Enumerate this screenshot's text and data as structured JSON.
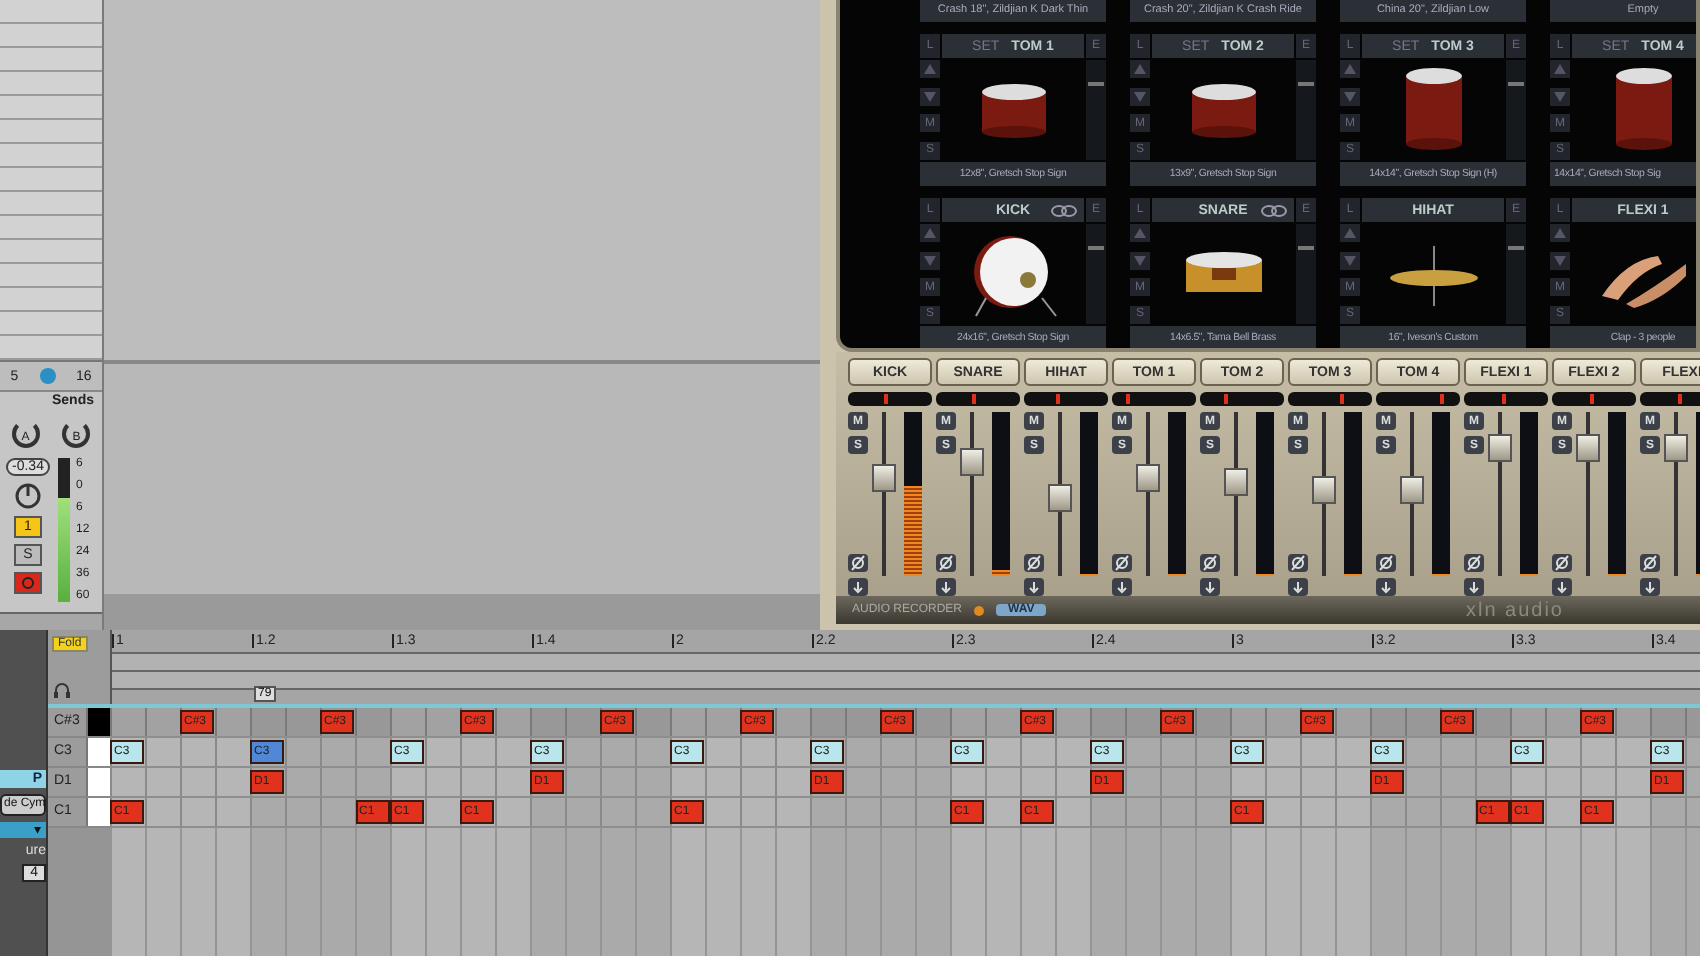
{
  "track": {
    "top": {
      "number": "5",
      "count": "16"
    },
    "sends_label": "Sends",
    "sends": [
      {
        "letter": "A"
      },
      {
        "letter": "B"
      }
    ],
    "volume": "-0.34",
    "meter": {
      "level": 0.72
    },
    "meter_scale": [
      "6",
      "0",
      "6",
      "12",
      "24",
      "36",
      "60"
    ],
    "track_button": {
      "label": "1",
      "on": true
    },
    "solo": {
      "label": "S",
      "on": false
    },
    "arm": {
      "on": true
    }
  },
  "plugin": {
    "top_captions": [
      "Crash 18\", Zildjian K Dark Thin",
      "Crash 20\", Zildjian K Crash Ride",
      "China 20\", Zildjian Low",
      "Empty"
    ],
    "pads": [
      {
        "label": "TOM 1",
        "set": "SET",
        "caption": "12x8\", Gretsch Stop Sign",
        "kind": "tom",
        "linked": false,
        "lock": "L",
        "edit": "E",
        "mute": "M",
        "solo": "S",
        "volume": {
          "level": 0.75
        }
      },
      {
        "label": "TOM 2",
        "set": "SET",
        "caption": "13x9\", Gretsch Stop Sign",
        "kind": "tom",
        "linked": false,
        "lock": "L",
        "edit": "E",
        "mute": "M",
        "solo": "S",
        "volume": {
          "level": 0.75
        }
      },
      {
        "label": "TOM 3",
        "set": "SET",
        "caption": "14x14\", Gretsch Stop Sign (H)",
        "kind": "floor-tom",
        "linked": false,
        "lock": "L",
        "edit": "E",
        "mute": "M",
        "solo": "S",
        "volume": {
          "level": 0.75
        }
      },
      {
        "label": "TOM 4",
        "set": "SET",
        "caption": "14x14\", Gretsch Stop Sig",
        "kind": "floor-tom",
        "linked": false,
        "lock": "L",
        "mute": "M",
        "solo": "S"
      },
      {
        "label": "KICK",
        "caption": "24x16\", Gretsch Stop Sign",
        "kind": "kick",
        "linked": true,
        "lock": "L",
        "edit": "E",
        "mute": "M",
        "solo": "S",
        "volume": {
          "level": 0.75
        }
      },
      {
        "label": "SNARE",
        "caption": "14x6.5\", Tama Bell Brass",
        "kind": "snare",
        "linked": true,
        "lock": "L",
        "edit": "E",
        "mute": "M",
        "solo": "S",
        "volume": {
          "level": 0.75
        }
      },
      {
        "label": "HIHAT",
        "caption": "16\", Iveson's Custom",
        "kind": "hihat",
        "linked": false,
        "lock": "L",
        "edit": "E",
        "mute": "M",
        "solo": "S",
        "volume": {
          "level": 0.75
        }
      },
      {
        "label": "FLEXI 1",
        "caption": "Clap - 3 people",
        "kind": "clap",
        "linked": false,
        "lock": "L",
        "mute": "M",
        "solo": "S"
      }
    ],
    "mixer": [
      {
        "name": "KICK",
        "mute": "M",
        "solo": "S",
        "pan": {
          "level": 0.45
        },
        "fader": {
          "level": 0.6
        },
        "meter": {
          "level": 0.55
        }
      },
      {
        "name": "SNARE",
        "mute": "M",
        "solo": "S",
        "pan": {
          "level": 0.45
        },
        "fader": {
          "level": 0.7
        },
        "meter": {
          "level": 0.04
        }
      },
      {
        "name": "HIHAT",
        "mute": "M",
        "solo": "S",
        "pan": {
          "level": 0.4
        },
        "fader": {
          "level": 0.48
        },
        "meter": {
          "level": 0
        }
      },
      {
        "name": "TOM 1",
        "mute": "M",
        "solo": "S",
        "pan": {
          "level": 0.2
        },
        "fader": {
          "level": 0.6
        },
        "meter": {
          "level": 0
        }
      },
      {
        "name": "TOM 2",
        "mute": "M",
        "solo": "S",
        "pan": {
          "level": 0.3
        },
        "fader": {
          "level": 0.57
        },
        "meter": {
          "level": 0
        }
      },
      {
        "name": "TOM 3",
        "mute": "M",
        "solo": "S",
        "pan": {
          "level": 0.65
        },
        "fader": {
          "level": 0.52
        },
        "meter": {
          "level": 0
        }
      },
      {
        "name": "TOM 4",
        "mute": "M",
        "solo": "S",
        "pan": {
          "level": 0.78
        },
        "fader": {
          "level": 0.52
        },
        "meter": {
          "level": 0
        }
      },
      {
        "name": "FLEXI 1",
        "mute": "M",
        "solo": "S",
        "pan": {
          "level": 0.48
        },
        "fader": {
          "level": 0.78
        },
        "meter": {
          "level": 0
        }
      },
      {
        "name": "FLEXI 2",
        "mute": "M",
        "solo": "S",
        "pan": {
          "level": 0.48
        },
        "fader": {
          "level": 0.78
        },
        "meter": {
          "level": 0
        }
      },
      {
        "name": "FLEXI",
        "mute": "M",
        "solo": "S",
        "pan": {
          "level": 0.48
        },
        "fader": {
          "level": 0.78
        },
        "meter": {
          "level": 0
        }
      }
    ],
    "footer": {
      "recorder": "AUDIO RECORDER",
      "format": "WAV",
      "logo": "xln audio"
    }
  },
  "clip": {
    "header": "P",
    "name": "de Cym",
    "dropdown": "▾",
    "signature_label": "ure",
    "signature": "4"
  },
  "piano_roll": {
    "fold": "Fold",
    "ruler": [
      "1",
      "1.2",
      "1.3",
      "1.4",
      "2",
      "2.2",
      "2.3",
      "2.4",
      "3",
      "3.2",
      "3.3",
      "3.4"
    ],
    "marker": "79",
    "rows": [
      {
        "key": "C#3",
        "black": true,
        "color": "#e0321c",
        "steps": [
          {
            "kind": "rest"
          },
          {
            "kind": "rest"
          },
          {
            "kind": "note",
            "label": "C#3",
            "selected": false
          },
          {
            "kind": "rest"
          },
          {
            "kind": "rest"
          },
          {
            "kind": "rest"
          },
          {
            "kind": "note",
            "label": "C#3",
            "selected": false
          },
          {
            "kind": "rest"
          },
          {
            "kind": "rest"
          },
          {
            "kind": "rest"
          },
          {
            "kind": "note",
            "label": "C#3",
            "selected": false
          },
          {
            "kind": "rest"
          },
          {
            "kind": "rest"
          },
          {
            "kind": "rest"
          },
          {
            "kind": "note",
            "label": "C#3",
            "selected": false
          },
          {
            "kind": "rest"
          },
          {
            "kind": "rest"
          },
          {
            "kind": "rest"
          },
          {
            "kind": "note",
            "label": "C#3",
            "selected": false
          },
          {
            "kind": "rest"
          },
          {
            "kind": "rest"
          },
          {
            "kind": "rest"
          },
          {
            "kind": "note",
            "label": "C#3",
            "selected": false
          },
          {
            "kind": "rest"
          },
          {
            "kind": "rest"
          },
          {
            "kind": "rest"
          },
          {
            "kind": "note",
            "label": "C#3",
            "selected": false
          },
          {
            "kind": "rest"
          },
          {
            "kind": "rest"
          },
          {
            "kind": "rest"
          },
          {
            "kind": "note",
            "label": "C#3",
            "selected": false
          },
          {
            "kind": "rest"
          },
          {
            "kind": "rest"
          },
          {
            "kind": "rest"
          },
          {
            "kind": "note",
            "label": "C#3",
            "selected": false
          },
          {
            "kind": "rest"
          },
          {
            "kind": "rest"
          },
          {
            "kind": "rest"
          },
          {
            "kind": "note",
            "label": "C#3",
            "selected": false
          },
          {
            "kind": "rest"
          },
          {
            "kind": "rest"
          },
          {
            "kind": "rest"
          },
          {
            "kind": "note",
            "label": "C#3",
            "selected": false
          }
        ]
      },
      {
        "key": "C3",
        "black": false,
        "color": "#b9e6ec",
        "steps": [
          {
            "kind": "note",
            "label": "C3",
            "selected": false
          },
          {
            "kind": "rest"
          },
          {
            "kind": "rest"
          },
          {
            "kind": "rest"
          },
          {
            "kind": "note",
            "label": "C3",
            "selected": true
          },
          {
            "kind": "rest"
          },
          {
            "kind": "rest"
          },
          {
            "kind": "rest"
          },
          {
            "kind": "note",
            "label": "C3",
            "selected": false
          },
          {
            "kind": "rest"
          },
          {
            "kind": "rest"
          },
          {
            "kind": "rest"
          },
          {
            "kind": "note",
            "label": "C3",
            "selected": false
          },
          {
            "kind": "rest"
          },
          {
            "kind": "rest"
          },
          {
            "kind": "rest"
          },
          {
            "kind": "note",
            "label": "C3",
            "selected": false
          },
          {
            "kind": "rest"
          },
          {
            "kind": "rest"
          },
          {
            "kind": "rest"
          },
          {
            "kind": "note",
            "label": "C3",
            "selected": false
          },
          {
            "kind": "rest"
          },
          {
            "kind": "rest"
          },
          {
            "kind": "rest"
          },
          {
            "kind": "note",
            "label": "C3",
            "selected": false
          },
          {
            "kind": "rest"
          },
          {
            "kind": "rest"
          },
          {
            "kind": "rest"
          },
          {
            "kind": "note",
            "label": "C3",
            "selected": false
          },
          {
            "kind": "rest"
          },
          {
            "kind": "rest"
          },
          {
            "kind": "rest"
          },
          {
            "kind": "note",
            "label": "C3",
            "selected": false
          },
          {
            "kind": "rest"
          },
          {
            "kind": "rest"
          },
          {
            "kind": "rest"
          },
          {
            "kind": "note",
            "label": "C3",
            "selected": false
          },
          {
            "kind": "rest"
          },
          {
            "kind": "rest"
          },
          {
            "kind": "rest"
          },
          {
            "kind": "note",
            "label": "C3",
            "selected": false
          },
          {
            "kind": "rest"
          },
          {
            "kind": "rest"
          },
          {
            "kind": "rest"
          },
          {
            "kind": "note",
            "label": "C3",
            "selected": false
          }
        ]
      },
      {
        "key": "D1",
        "black": false,
        "color": "#e0321c",
        "steps": [
          {
            "kind": "rest"
          },
          {
            "kind": "rest"
          },
          {
            "kind": "rest"
          },
          {
            "kind": "rest"
          },
          {
            "kind": "note",
            "label": "D1",
            "selected": false
          },
          {
            "kind": "rest"
          },
          {
            "kind": "rest"
          },
          {
            "kind": "rest"
          },
          {
            "kind": "rest"
          },
          {
            "kind": "rest"
          },
          {
            "kind": "rest"
          },
          {
            "kind": "rest"
          },
          {
            "kind": "note",
            "label": "D1",
            "selected": false
          },
          {
            "kind": "rest"
          },
          {
            "kind": "rest"
          },
          {
            "kind": "rest"
          },
          {
            "kind": "rest"
          },
          {
            "kind": "rest"
          },
          {
            "kind": "rest"
          },
          {
            "kind": "rest"
          },
          {
            "kind": "note",
            "label": "D1",
            "selected": false
          },
          {
            "kind": "rest"
          },
          {
            "kind": "rest"
          },
          {
            "kind": "rest"
          },
          {
            "kind": "rest"
          },
          {
            "kind": "rest"
          },
          {
            "kind": "rest"
          },
          {
            "kind": "rest"
          },
          {
            "kind": "note",
            "label": "D1",
            "selected": false
          },
          {
            "kind": "rest"
          },
          {
            "kind": "rest"
          },
          {
            "kind": "rest"
          },
          {
            "kind": "rest"
          },
          {
            "kind": "rest"
          },
          {
            "kind": "rest"
          },
          {
            "kind": "rest"
          },
          {
            "kind": "note",
            "label": "D1",
            "selected": false
          },
          {
            "kind": "rest"
          },
          {
            "kind": "rest"
          },
          {
            "kind": "rest"
          },
          {
            "kind": "rest"
          },
          {
            "kind": "rest"
          },
          {
            "kind": "rest"
          },
          {
            "kind": "rest"
          },
          {
            "kind": "note",
            "label": "D1",
            "selected": false
          }
        ]
      },
      {
        "key": "C1",
        "black": false,
        "color": "#e0321c",
        "steps": [
          {
            "kind": "note",
            "label": "C1",
            "selected": false
          },
          {
            "kind": "rest"
          },
          {
            "kind": "rest"
          },
          {
            "kind": "rest"
          },
          {
            "kind": "rest"
          },
          {
            "kind": "rest"
          },
          {
            "kind": "rest"
          },
          {
            "kind": "note",
            "label": "C1",
            "selected": false
          },
          {
            "kind": "note",
            "label": "C1",
            "selected": false
          },
          {
            "kind": "rest"
          },
          {
            "kind": "note",
            "label": "C1",
            "selected": false
          },
          {
            "kind": "rest"
          },
          {
            "kind": "rest"
          },
          {
            "kind": "rest"
          },
          {
            "kind": "rest"
          },
          {
            "kind": "rest"
          },
          {
            "kind": "note",
            "label": "C1",
            "selected": false
          },
          {
            "kind": "rest"
          },
          {
            "kind": "rest"
          },
          {
            "kind": "rest"
          },
          {
            "kind": "rest"
          },
          {
            "kind": "rest"
          },
          {
            "kind": "rest"
          },
          {
            "kind": "rest"
          },
          {
            "kind": "note",
            "label": "C1",
            "selected": false
          },
          {
            "kind": "rest"
          },
          {
            "kind": "note",
            "label": "C1",
            "selected": false
          },
          {
            "kind": "rest"
          },
          {
            "kind": "rest"
          },
          {
            "kind": "rest"
          },
          {
            "kind": "rest"
          },
          {
            "kind": "rest"
          },
          {
            "kind": "note",
            "label": "C1",
            "selected": false
          },
          {
            "kind": "rest"
          },
          {
            "kind": "rest"
          },
          {
            "kind": "rest"
          },
          {
            "kind": "rest"
          },
          {
            "kind": "rest"
          },
          {
            "kind": "rest"
          },
          {
            "kind": "note",
            "label": "C1",
            "selected": false
          },
          {
            "kind": "note",
            "label": "C1",
            "selected": false
          },
          {
            "kind": "rest"
          },
          {
            "kind": "note",
            "label": "C1",
            "selected": false
          }
        ]
      }
    ]
  }
}
